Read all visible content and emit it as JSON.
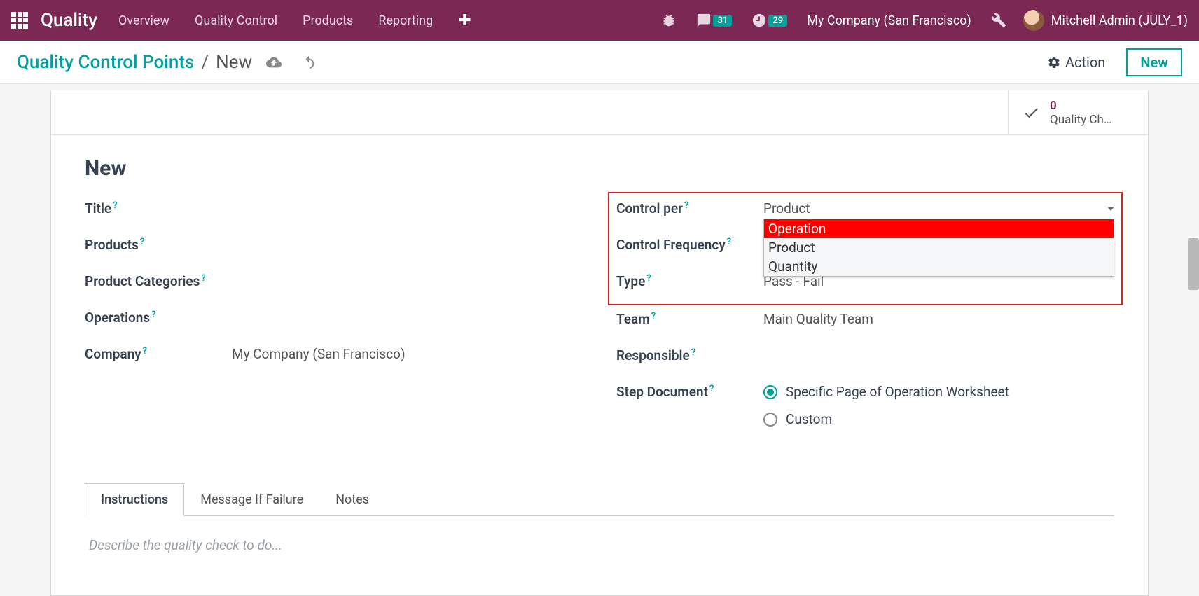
{
  "navbar": {
    "brand": "Quality",
    "items": [
      "Overview",
      "Quality Control",
      "Products",
      "Reporting"
    ],
    "messages_badge": "31",
    "activities_badge": "29",
    "company": "My Company (San Francisco)",
    "user": "Mitchell Admin (JULY_1)"
  },
  "breadcrumb": {
    "parent": "Quality Control Points",
    "current": "New",
    "action_label": "Action",
    "new_label": "New"
  },
  "stat": {
    "count": "0",
    "label": "Quality Ch…"
  },
  "form": {
    "title": "New",
    "left": {
      "title_label": "Title",
      "products_label": "Products",
      "categories_label": "Product Categories",
      "operations_label": "Operations",
      "company_label": "Company",
      "company_value": "My Company (San Francisco)"
    },
    "right": {
      "control_per_label": "Control per",
      "control_per_value": "Product",
      "control_per_options": [
        "Operation",
        "Product",
        "Quantity"
      ],
      "control_freq_label": "Control Frequency",
      "type_label": "Type",
      "type_value": "Pass - Fail",
      "team_label": "Team",
      "team_value": "Main Quality Team",
      "responsible_label": "Responsible",
      "step_doc_label": "Step Document",
      "step_doc_opt1": "Specific Page of Operation Worksheet",
      "step_doc_opt2": "Custom"
    }
  },
  "tabs": {
    "items": [
      "Instructions",
      "Message If Failure",
      "Notes"
    ],
    "placeholder": "Describe the quality check to do..."
  }
}
